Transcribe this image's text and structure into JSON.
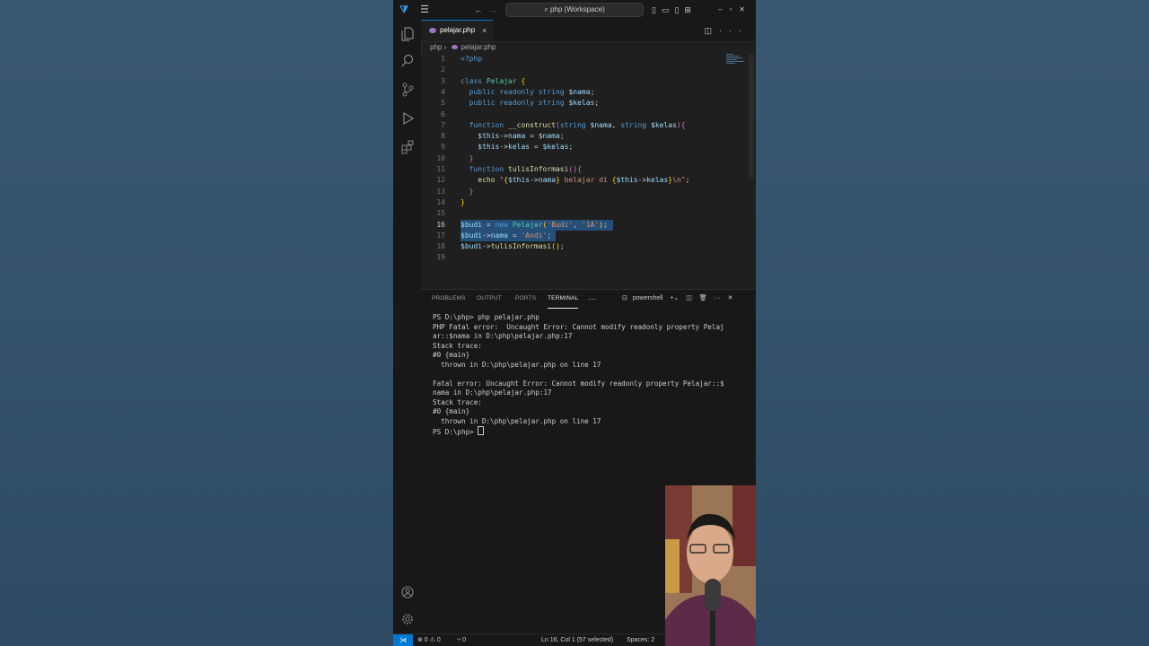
{
  "titlebar": {
    "command_center": "php (Workspace)"
  },
  "tab": {
    "label": "pelajar.php",
    "close": "×"
  },
  "breadcrumb": {
    "folder": "php",
    "file": "pelajar.php"
  },
  "editor": {
    "line_numbers": [
      "1",
      "2",
      "3",
      "4",
      "5",
      "6",
      "7",
      "8",
      "9",
      "10",
      "11",
      "12",
      "13",
      "14",
      "15",
      "16",
      "17",
      "18",
      "19"
    ],
    "selected_lines": [
      16,
      17
    ]
  },
  "panel": {
    "tabs": [
      "PROBLEMS",
      "OUTPUT",
      "PORTS",
      "TERMINAL"
    ],
    "more": "···",
    "shell": "powershell"
  },
  "terminal": {
    "lines": [
      "PS D:\\php> php pelajar.php",
      "PHP Fatal error:  Uncaught Error: Cannot modify readonly property Pelaj",
      "ar::$nama in D:\\php\\pelajar.php:17",
      "Stack trace:",
      "#0 {main}",
      "  thrown in D:\\php\\pelajar.php on line 17",
      "",
      "Fatal error: Uncaught Error: Cannot modify readonly property Pelajar::$",
      "nama in D:\\php\\pelajar.php:17",
      "Stack trace:",
      "#0 {main}",
      "  thrown in D:\\php\\pelajar.php on line 17"
    ],
    "prompt": "PS D:\\php> "
  },
  "statusbar": {
    "problems": "⊗ 0 ⚠ 0",
    "ports": "⑂ 0",
    "position": "Ln 16, Col 1 (57 selected)",
    "spaces": "Spaces: 2"
  },
  "colors": {
    "accent": "#0078d4",
    "selection": "#264f78",
    "editor_bg": "#1f1f1f"
  }
}
